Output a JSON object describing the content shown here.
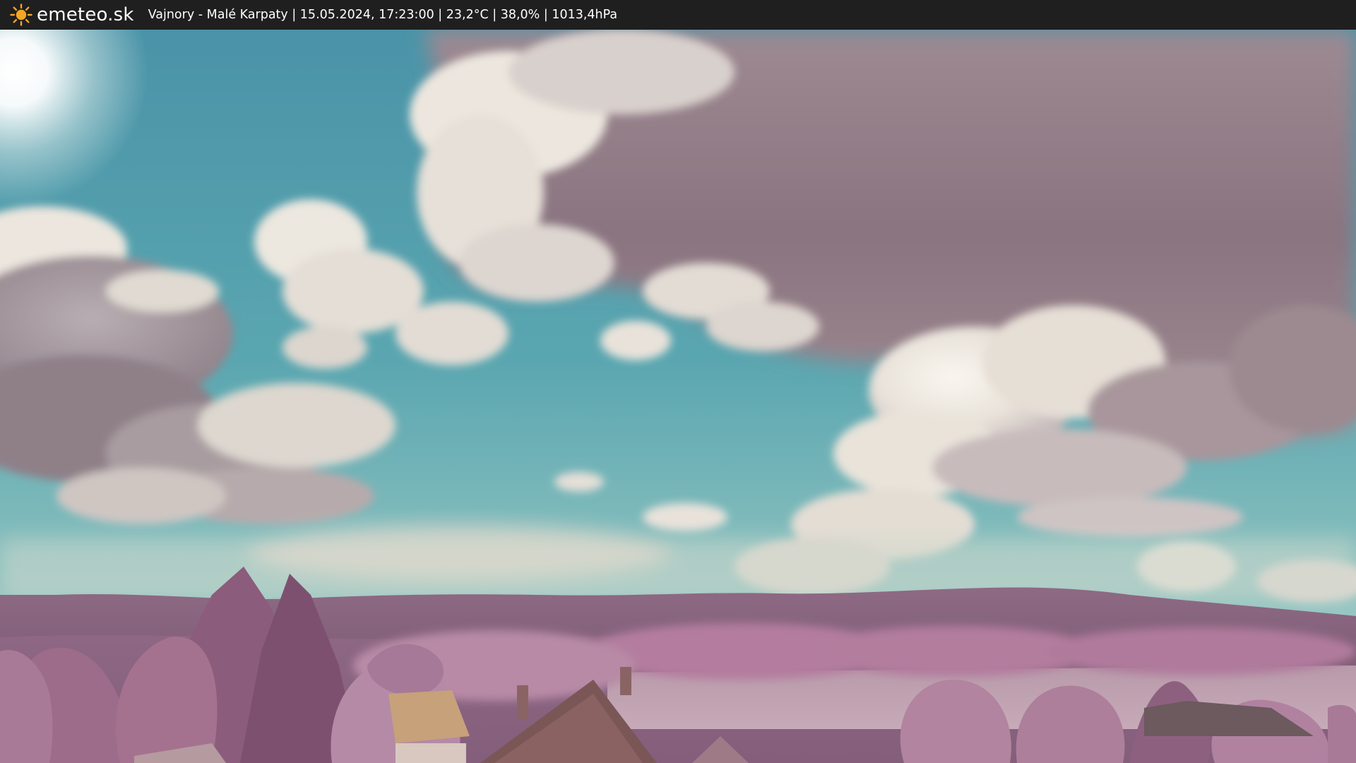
{
  "header": {
    "brand": "emeteo.sk",
    "logo_icon": "sun-icon",
    "caption": "Vajnory - Malé Karpaty | 15.05.2024, 17:23:00 | 23,2°C | 38,0% | 1013,4hPa"
  },
  "webcam_image": {
    "icon": "webcam-landscape-image"
  },
  "colors": {
    "bar": "#1f1f1f",
    "sun": "#f5a623",
    "sky_top": "#4f99aa",
    "sky_horizon": "#c3ddd4",
    "cloud_light": "#f2ede6",
    "cloud_dark": "#8a7480",
    "foliage": "#b07a9c",
    "hills": "#7c5a72"
  }
}
